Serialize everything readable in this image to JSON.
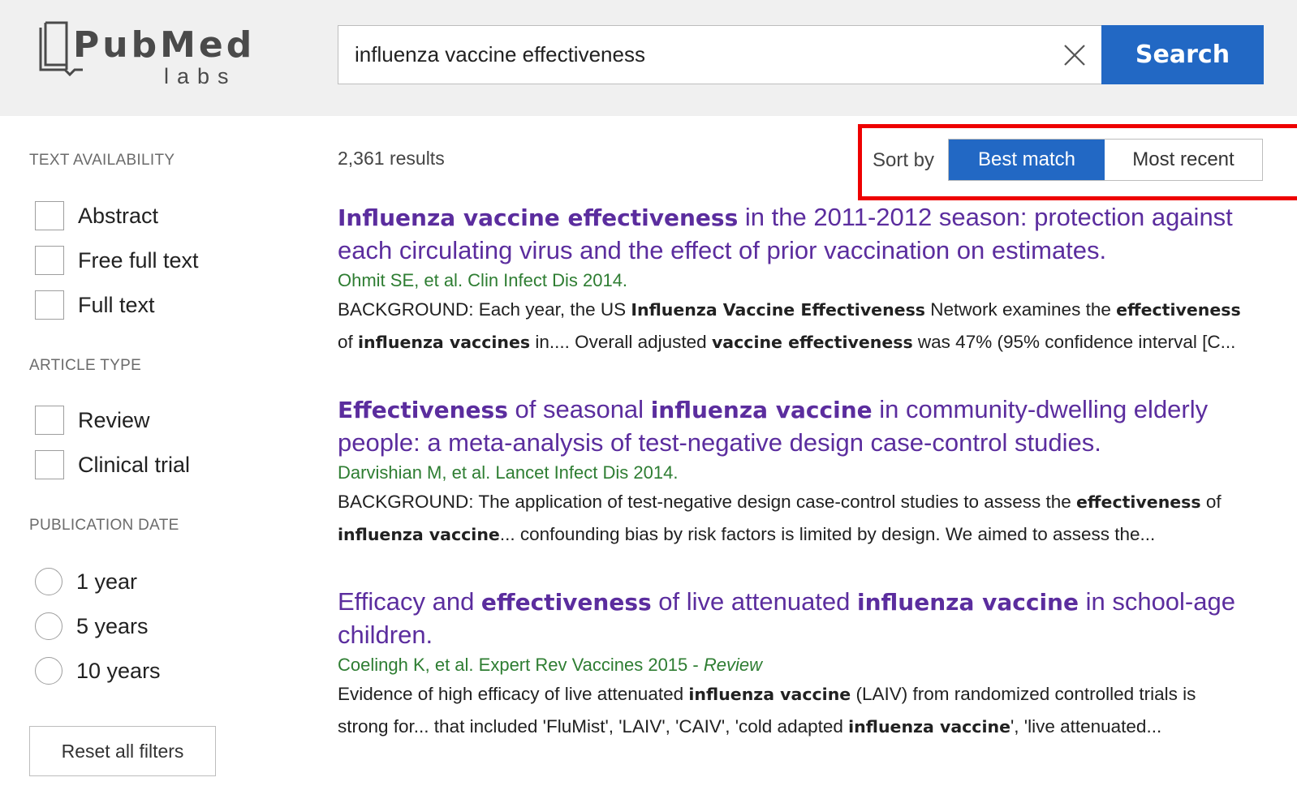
{
  "header": {
    "logo_main": "PubMed",
    "logo_sub": "labs",
    "search_value": "influenza vaccine effectiveness",
    "search_button": "Search"
  },
  "sidebar": {
    "text_availability_title": "TEXT AVAILABILITY",
    "text_availability": [
      "Abstract",
      "Free full text",
      "Full text"
    ],
    "article_type_title": "ARTICLE TYPE",
    "article_type": [
      "Review",
      "Clinical trial"
    ],
    "publication_date_title": "PUBLICATION DATE",
    "publication_date": [
      "1 year",
      "5 years",
      "10 years"
    ],
    "reset_label": "Reset all filters"
  },
  "results": {
    "count": "2,361 results",
    "sort_label": "Sort by",
    "sort_options": [
      "Best match",
      "Most recent"
    ],
    "sort_selected": "Best match",
    "items": [
      {
        "title": [
          {
            "t": "Influenza vaccine effectiveness",
            "b": true
          },
          {
            "t": " in the 2011-2012 season: protection against each circulating virus and the effect of prior vaccination on estimates.",
            "b": false
          }
        ],
        "citation": "Ohmit SE, et al. Clin Infect Dis 2014.",
        "review": "",
        "snippet_lines": [
          [
            {
              "t": "BACKGROUND: Each year, the US ",
              "b": false
            },
            {
              "t": "Influenza Vaccine Effectiveness",
              "b": true
            },
            {
              "t": " Network examines the ",
              "b": false
            },
            {
              "t": "effectiveness",
              "b": true
            }
          ],
          [
            {
              "t": "of ",
              "b": false
            },
            {
              "t": "influenza vaccines",
              "b": true
            },
            {
              "t": " in.... Overall adjusted ",
              "b": false
            },
            {
              "t": "vaccine effectiveness",
              "b": true
            },
            {
              "t": " was 47% (95% confidence interval [C...",
              "b": false
            }
          ]
        ]
      },
      {
        "title": [
          {
            "t": "Effectiveness",
            "b": true
          },
          {
            "t": " of seasonal ",
            "b": false
          },
          {
            "t": "influenza vaccine",
            "b": true
          },
          {
            "t": " in community-dwelling elderly people: a meta-analysis of test-negative design case-control studies.",
            "b": false
          }
        ],
        "citation": "Darvishian M, et al. Lancet Infect Dis 2014.",
        "review": "",
        "snippet_lines": [
          [
            {
              "t": "BACKGROUND: The application of test-negative design case-control studies to assess the ",
              "b": false
            },
            {
              "t": "effectiveness",
              "b": true
            },
            {
              "t": " of",
              "b": false
            }
          ],
          [
            {
              "t": "influenza vaccine",
              "b": true
            },
            {
              "t": "... confounding bias by risk factors is limited by design. We aimed to assess the...",
              "b": false
            }
          ]
        ]
      },
      {
        "title": [
          {
            "t": "Efficacy and ",
            "b": false
          },
          {
            "t": "effectiveness",
            "b": true
          },
          {
            "t": " of live attenuated ",
            "b": false
          },
          {
            "t": "influenza vaccine",
            "b": true
          },
          {
            "t": " in school-age children.",
            "b": false
          }
        ],
        "citation": "Coelingh K, et al. Expert Rev Vaccines 2015 - ",
        "review": "Review",
        "snippet_lines": [
          [
            {
              "t": "Evidence of high efficacy of live attenuated ",
              "b": false
            },
            {
              "t": "influenza vaccine",
              "b": true
            },
            {
              "t": " (LAIV) from randomized controlled trials is",
              "b": false
            }
          ],
          [
            {
              "t": "strong for... that included 'FluMist', 'LAIV', 'CAIV', 'cold adapted ",
              "b": false
            },
            {
              "t": "influenza vaccine",
              "b": true
            },
            {
              "t": "', 'live attenuated...",
              "b": false
            }
          ]
        ]
      }
    ]
  },
  "colors": {
    "accent": "#2268c4",
    "title": "#5b2d9e",
    "citation": "#2e7d32",
    "highlight": "#ee0000",
    "header_bg": "#f0f0f0"
  },
  "icons": {
    "logo": "book-icon",
    "clear": "close-icon"
  }
}
